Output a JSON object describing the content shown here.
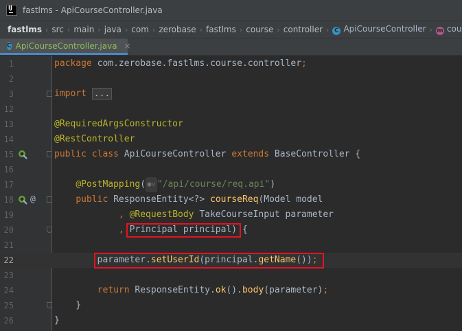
{
  "window": {
    "title": "fastlms - ApiCourseController.java"
  },
  "breadcrumb": {
    "items": [
      "fastlms",
      "src",
      "main",
      "java",
      "com",
      "zerobase",
      "fastlms",
      "course",
      "controller"
    ],
    "class_name": "ApiCourseController",
    "method_name": "courseReq"
  },
  "tab": {
    "label": "ApiCourseController.java",
    "close": "×"
  },
  "editor": {
    "lines": [
      {
        "num": "1",
        "tokens": [
          [
            "kw",
            "package "
          ],
          [
            "plain",
            "com.zerobase.fastlms.course.controller"
          ],
          [
            "kw",
            ";"
          ]
        ]
      },
      {
        "num": "2",
        "tokens": []
      },
      {
        "num": "3",
        "tokens": [
          [
            "kw",
            "import "
          ],
          [
            "fold",
            "..."
          ]
        ]
      },
      {
        "num": "12",
        "tokens": []
      },
      {
        "num": "13",
        "tokens": [
          [
            "ann",
            "@RequiredArgsConstructor"
          ]
        ]
      },
      {
        "num": "14",
        "tokens": [
          [
            "ann",
            "@RestController"
          ]
        ]
      },
      {
        "num": "15",
        "tokens": [
          [
            "kw",
            "public class "
          ],
          [
            "plain",
            "ApiCourseController "
          ],
          [
            "kw",
            "extends "
          ],
          [
            "plain",
            "BaseController {"
          ]
        ]
      },
      {
        "num": "16",
        "tokens": []
      },
      {
        "num": "17",
        "tokens": [
          [
            "plain",
            "    "
          ],
          [
            "ann",
            "@PostMapping"
          ],
          [
            "plain",
            "("
          ],
          [
            "hint",
            "⊛˅"
          ],
          [
            "str",
            "\"/api/course/req.api\""
          ],
          [
            "plain",
            ")"
          ]
        ]
      },
      {
        "num": "18",
        "tokens": [
          [
            "plain",
            "    "
          ],
          [
            "kw",
            "public "
          ],
          [
            "plain",
            "ResponseEntity<?> "
          ],
          [
            "mth",
            "courseReq"
          ],
          [
            "plain",
            "(Model model"
          ]
        ]
      },
      {
        "num": "19",
        "tokens": [
          [
            "plain",
            "            "
          ],
          [
            "kw",
            ", "
          ],
          [
            "ann",
            "@RequestBody "
          ],
          [
            "plain",
            "TakeCourseInput parameter"
          ]
        ]
      },
      {
        "num": "20",
        "tokens": [
          [
            "plain",
            "            "
          ],
          [
            "kw",
            ", "
          ],
          [
            "plain",
            "Principal principal) {"
          ]
        ]
      },
      {
        "num": "21",
        "tokens": []
      },
      {
        "num": "22",
        "tokens": [
          [
            "plain",
            "        parameter."
          ],
          [
            "mth",
            "setUserId"
          ],
          [
            "plain",
            "(principal."
          ],
          [
            "mth",
            "getName"
          ],
          [
            "plain",
            "())"
          ],
          [
            "kw",
            ";"
          ]
        ]
      },
      {
        "num": "23",
        "tokens": []
      },
      {
        "num": "24",
        "tokens": [
          [
            "plain",
            "        "
          ],
          [
            "kw",
            "return "
          ],
          [
            "plain",
            "ResponseEntity."
          ],
          [
            "mth",
            "ok"
          ],
          [
            "plain",
            "()."
          ],
          [
            "mth",
            "body"
          ],
          [
            "plain",
            "(parameter)"
          ],
          [
            "kw",
            ";"
          ]
        ]
      },
      {
        "num": "25",
        "tokens": [
          [
            "plain",
            "    }"
          ]
        ]
      },
      {
        "num": "26",
        "tokens": [
          [
            "plain",
            "}"
          ]
        ]
      }
    ],
    "current_line": "22",
    "gutter_marker_18": "@"
  }
}
